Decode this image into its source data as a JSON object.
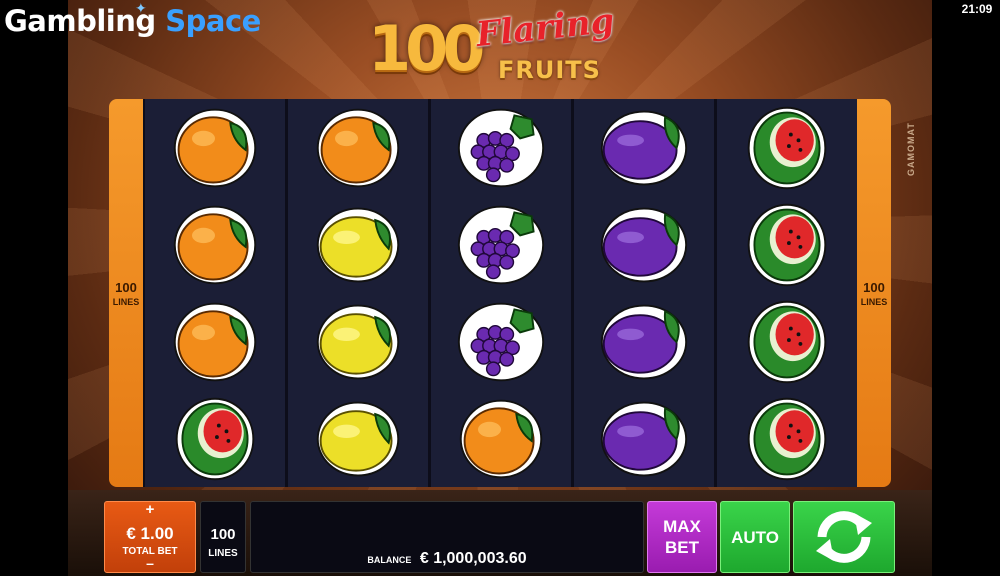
{
  "watermark": {
    "word1": "Gambling",
    "word2": "Space"
  },
  "status": {
    "time": "21:09"
  },
  "logo": {
    "number": "100",
    "word1": "Flaring",
    "word2": "FRUITS"
  },
  "provider": "GAMOMAT",
  "lines_left": {
    "value": "100",
    "label": "LINES"
  },
  "lines_right": {
    "value": "100",
    "label": "LINES"
  },
  "reels": [
    [
      "orange",
      "orange",
      "orange",
      "watermelon"
    ],
    [
      "orange",
      "lemon",
      "lemon",
      "lemon"
    ],
    [
      "grapes",
      "grapes",
      "grapes",
      "orange"
    ],
    [
      "plum",
      "plum",
      "plum",
      "plum"
    ],
    [
      "watermelon",
      "watermelon",
      "watermelon",
      "watermelon"
    ]
  ],
  "controls": {
    "bet_plus": "+",
    "bet_amount": "€ 1.00",
    "bet_label": "TOTAL BET",
    "bet_minus": "–",
    "lines_value": "100",
    "lines_label": "LINES",
    "balance_label": "BALANCE",
    "balance_value": "€ 1,000,003.60",
    "maxbet_line1": "MAX",
    "maxbet_line2": "BET",
    "auto_label": "AUTO",
    "spin_icon": "spin-arrows-icon"
  },
  "colors": {
    "reel_bg": "#1b1e36",
    "total_bet": "#e85a14",
    "max_bet": "#b52ac8",
    "auto": "#2cc23c",
    "lines_tab": "#f08a20"
  }
}
